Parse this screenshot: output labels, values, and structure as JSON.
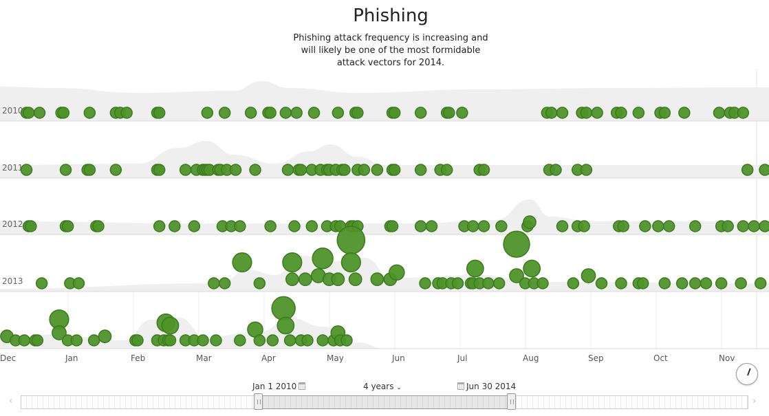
{
  "header": {
    "title": "Phishing",
    "description": [
      "Phishing attack frequency is increasing and",
      "will likely be one of the most formidable",
      "attack vectors for 2014."
    ]
  },
  "controls": {
    "start_date": "Jan 1 2010",
    "range": "4 years",
    "end_date": "Jun 30 2014",
    "range_options_icon": "chevron-down-icon",
    "calendar_icon": "calendar-icon",
    "clock_icon": "clock-icon"
  },
  "colors": {
    "bubble": "#4e9429",
    "bubble_stroke": "#3b7a1c",
    "density": "#efefef",
    "baseline": "#d8d8d8"
  },
  "chart_data": {
    "type": "scatter",
    "x_ticks": [
      "Dec",
      "Jan",
      "Feb",
      "Mar",
      "Apr",
      "May",
      "Jun",
      "Jul",
      "Aug",
      "Sep",
      "Oct",
      "Nov"
    ],
    "rows": [
      {
        "label": "2010",
        "points": [
          [
            "12-10",
            1
          ],
          [
            "12-11",
            1
          ],
          [
            "12-16",
            1
          ],
          [
            "12-26",
            1
          ],
          [
            "12-27",
            1
          ],
          [
            "01-09",
            1
          ],
          [
            "01-21",
            1
          ],
          [
            "01-23",
            1
          ],
          [
            "01-26",
            1
          ],
          [
            "02-10",
            1
          ],
          [
            "02-11",
            1
          ],
          [
            "03-03",
            1
          ],
          [
            "03-11",
            1
          ],
          [
            "03-23",
            1
          ],
          [
            "04-01",
            1
          ],
          [
            "04-02",
            1
          ],
          [
            "04-09",
            1
          ],
          [
            "04-14",
            1
          ],
          [
            "04-22",
            1
          ],
          [
            "05-03",
            1
          ],
          [
            "05-11",
            1
          ],
          [
            "05-12",
            1
          ],
          [
            "05-28",
            1
          ],
          [
            "05-29",
            1
          ],
          [
            "06-11",
            1
          ],
          [
            "06-23",
            1
          ],
          [
            "06-24",
            1
          ],
          [
            "06-30",
            1
          ],
          [
            "08-09",
            1
          ],
          [
            "08-11",
            1
          ],
          [
            "08-16",
            1
          ],
          [
            "08-25",
            1
          ],
          [
            "08-27",
            1
          ],
          [
            "09-02",
            1
          ],
          [
            "09-11",
            1
          ],
          [
            "09-13",
            1
          ],
          [
            "09-21",
            1
          ],
          [
            "10-01",
            1
          ],
          [
            "10-03",
            1
          ],
          [
            "10-12",
            1
          ],
          [
            "10-28",
            1
          ],
          [
            "11-03",
            1
          ],
          [
            "11-05",
            1
          ],
          [
            "11-09",
            1
          ]
        ]
      },
      {
        "label": "2011",
        "points": [
          [
            "12-10",
            1
          ],
          [
            "12-28",
            1
          ],
          [
            "01-08",
            1
          ],
          [
            "01-09",
            1
          ],
          [
            "01-21",
            1
          ],
          [
            "02-10",
            1
          ],
          [
            "02-11",
            1
          ],
          [
            "02-23",
            1
          ],
          [
            "02-28",
            1
          ],
          [
            "03-01",
            1
          ],
          [
            "03-02",
            1
          ],
          [
            "03-03",
            1
          ],
          [
            "03-04",
            1
          ],
          [
            "03-08",
            1
          ],
          [
            "03-09",
            1
          ],
          [
            "03-12",
            1
          ],
          [
            "03-16",
            1
          ],
          [
            "03-25",
            1
          ],
          [
            "04-10",
            1
          ],
          [
            "04-15",
            1
          ],
          [
            "04-16",
            1
          ],
          [
            "04-21",
            1
          ],
          [
            "04-25",
            1
          ],
          [
            "04-28",
            1
          ],
          [
            "04-29",
            1
          ],
          [
            "05-02",
            1
          ],
          [
            "05-05",
            1
          ],
          [
            "05-06",
            1
          ],
          [
            "05-12",
            1
          ],
          [
            "05-15",
            1
          ],
          [
            "05-21",
            1
          ],
          [
            "05-28",
            1
          ],
          [
            "05-29",
            1
          ],
          [
            "06-11",
            1
          ],
          [
            "06-20",
            1
          ],
          [
            "06-23",
            1
          ],
          [
            "07-08",
            1
          ],
          [
            "07-10",
            1
          ],
          [
            "08-10",
            1
          ],
          [
            "08-13",
            1
          ],
          [
            "08-23",
            1
          ],
          [
            "08-27",
            1
          ],
          [
            "11-11",
            1
          ],
          [
            "11-19",
            1
          ]
        ]
      },
      {
        "label": "2012",
        "points": [
          [
            "12-11",
            1
          ],
          [
            "12-12",
            1
          ],
          [
            "12-28",
            1
          ],
          [
            "12-29",
            1
          ],
          [
            "01-12",
            1
          ],
          [
            "01-13",
            1
          ],
          [
            "02-11",
            1
          ],
          [
            "02-18",
            1
          ],
          [
            "02-27",
            1
          ],
          [
            "03-10",
            1
          ],
          [
            "03-14",
            1
          ],
          [
            "03-18",
            1
          ],
          [
            "04-02",
            1
          ],
          [
            "04-13",
            1
          ],
          [
            "04-21",
            1
          ],
          [
            "04-28",
            1
          ],
          [
            "05-02",
            1
          ],
          [
            "05-04",
            1
          ],
          [
            "05-09",
            1
          ],
          [
            "05-10",
            1
          ],
          [
            "05-12",
            1
          ],
          [
            "05-27",
            1
          ],
          [
            "05-28",
            1
          ],
          [
            "06-11",
            1
          ],
          [
            "06-16",
            1
          ],
          [
            "07-01",
            1
          ],
          [
            "07-05",
            1
          ],
          [
            "07-10",
            1
          ],
          [
            "07-18",
            1
          ],
          [
            "07-30",
            1
          ],
          [
            "08-01",
            1.3
          ],
          [
            "08-16",
            1
          ],
          [
            "08-23",
            1
          ],
          [
            "08-26",
            1
          ],
          [
            "09-12",
            1
          ],
          [
            "09-14",
            1
          ],
          [
            "09-24",
            1
          ],
          [
            "09-30",
            1
          ],
          [
            "10-05",
            1
          ],
          [
            "10-17",
            1
          ],
          [
            "10-29",
            1
          ],
          [
            "11-02",
            1
          ],
          [
            "11-09",
            1
          ],
          [
            "11-14",
            1
          ],
          [
            "11-19",
            1
          ]
        ]
      },
      {
        "label": "2013",
        "points": [
          [
            "12-17",
            1
          ],
          [
            "12-30",
            1
          ],
          [
            "01-04",
            1
          ],
          [
            "03-06",
            1
          ],
          [
            "03-11",
            1
          ],
          [
            "03-19",
            3
          ],
          [
            "03-27",
            1
          ],
          [
            "04-12",
            3
          ],
          [
            "04-12",
            1.3
          ],
          [
            "04-18",
            1.3
          ],
          [
            "04-24",
            1.6
          ],
          [
            "04-26",
            3.5
          ],
          [
            "04-29",
            1.3
          ],
          [
            "05-03",
            1.3
          ],
          [
            "05-09",
            6.3
          ],
          [
            "05-09",
            3
          ],
          [
            "05-11",
            1.3
          ],
          [
            "05-21",
            1.3
          ],
          [
            "05-27",
            1.3
          ],
          [
            "05-30",
            1.9
          ],
          [
            "06-13",
            1
          ],
          [
            "06-19",
            1
          ],
          [
            "06-21",
            1
          ],
          [
            "06-25",
            1
          ],
          [
            "06-28",
            1
          ],
          [
            "07-04",
            1
          ],
          [
            "07-05",
            1
          ],
          [
            "07-06",
            2.3
          ],
          [
            "07-08",
            1
          ],
          [
            "07-12",
            1
          ],
          [
            "07-17",
            1
          ],
          [
            "07-25",
            5.6
          ],
          [
            "07-25",
            1.6
          ],
          [
            "07-29",
            1
          ],
          [
            "08-02",
            2.3
          ],
          [
            "08-03",
            1
          ],
          [
            "08-07",
            1
          ],
          [
            "08-21",
            1
          ],
          [
            "08-28",
            1.6
          ],
          [
            "09-04",
            1
          ],
          [
            "09-13",
            1
          ],
          [
            "09-21",
            1
          ],
          [
            "09-23",
            1
          ],
          [
            "10-03",
            1
          ],
          [
            "10-11",
            1
          ],
          [
            "10-17",
            1
          ],
          [
            "10-22",
            1
          ],
          [
            "10-29",
            1
          ],
          [
            "11-08",
            1
          ],
          [
            "11-17",
            1
          ]
        ]
      },
      {
        "label": "",
        "points": [
          [
            "12-01",
            1.3
          ],
          [
            "12-05",
            1
          ],
          [
            "12-09",
            1
          ],
          [
            "12-14",
            1
          ],
          [
            "12-15",
            1
          ],
          [
            "12-25",
            3
          ],
          [
            "12-25",
            1.6
          ],
          [
            "12-29",
            1
          ],
          [
            "01-03",
            1
          ],
          [
            "01-11",
            1
          ],
          [
            "01-16",
            1.3
          ],
          [
            "01-30",
            1
          ],
          [
            "02-01",
            1
          ],
          [
            "02-10",
            1
          ],
          [
            "02-13",
            1
          ],
          [
            "02-14",
            2.6
          ],
          [
            "02-15",
            1
          ],
          [
            "02-16",
            2.3
          ],
          [
            "02-16",
            1
          ],
          [
            "02-23",
            1
          ],
          [
            "02-27",
            1
          ],
          [
            "03-01",
            1
          ],
          [
            "03-07",
            1
          ],
          [
            "03-18",
            1
          ],
          [
            "03-25",
            1.9
          ],
          [
            "03-27",
            1
          ],
          [
            "04-03",
            1
          ],
          [
            "04-08",
            4.5
          ],
          [
            "04-09",
            2.3
          ],
          [
            "04-11",
            1
          ],
          [
            "04-16",
            1
          ],
          [
            "04-19",
            1
          ],
          [
            "04-26",
            1
          ],
          [
            "05-01",
            1
          ],
          [
            "05-03",
            1.6
          ],
          [
            "05-04",
            1
          ],
          [
            "05-07",
            1
          ]
        ]
      }
    ]
  }
}
